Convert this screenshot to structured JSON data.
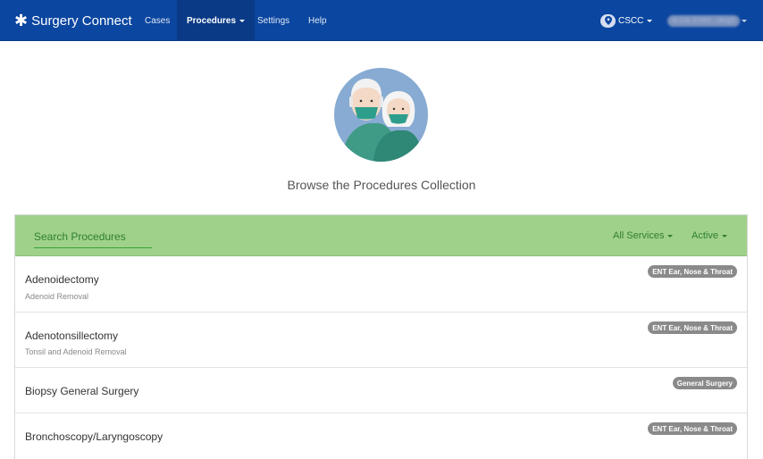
{
  "brand": {
    "name": "Surgery Connect"
  },
  "nav": {
    "cases": "Cases",
    "procedures": "Procedures",
    "settings": "Settings",
    "help": "Help"
  },
  "location": {
    "label": "CSCC",
    "icon": "map-pin-icon"
  },
  "user": {
    "label": "ALCAL EVRO · cfergl2"
  },
  "hero": {
    "subtitle": "Browse the Procedures Collection",
    "image": "masked-elderly-couple-illustration"
  },
  "search": {
    "placeholder": "Search Procedures"
  },
  "filters": {
    "services": "All Services",
    "status": "Active"
  },
  "procedures": [
    {
      "name": "Adenoidectomy",
      "description": "Adenoid Removal",
      "badge": "ENT Ear, Nose & Throat"
    },
    {
      "name": "Adenotonsillectomy",
      "description": "Tonsil and Adenoid Removal",
      "badge": "ENT Ear, Nose & Throat"
    },
    {
      "name": "Biopsy General Surgery",
      "description": "",
      "badge": "General Surgery"
    },
    {
      "name": "Bronchoscopy/Laryngoscopy",
      "description": "",
      "badge": "ENT Ear, Nose & Throat"
    }
  ],
  "colors": {
    "navbar": "#0b46a0",
    "search_bar": "#a0d18a",
    "search_text": "#2f7f33",
    "badge": "#8a8a8a"
  }
}
